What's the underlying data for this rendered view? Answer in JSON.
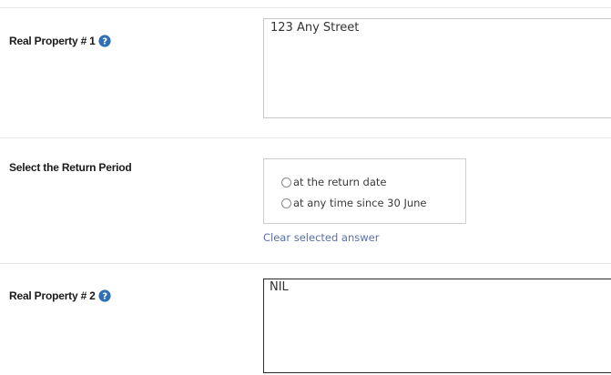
{
  "fields": {
    "property1": {
      "label": "Real Property # 1",
      "value": "123 Any Street"
    },
    "return_period": {
      "label": "Select the Return Period",
      "options": [
        "at the return date",
        "at any time since 30 June"
      ],
      "clear_label": "Clear selected answer"
    },
    "property2": {
      "label": "Real Property # 2",
      "value": "NIL"
    }
  },
  "icons": {
    "help": "question-circle-icon"
  },
  "colors": {
    "help_icon": "#2f6fb5",
    "link": "#5a6fae",
    "border": "#c8c8c8",
    "active_border": "#2a2a2a"
  }
}
